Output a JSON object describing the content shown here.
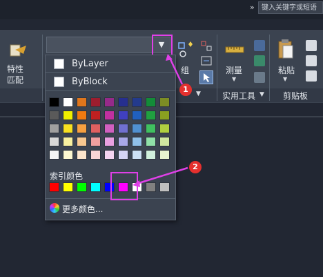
{
  "search": {
    "placeholder": "键入关键字或短语"
  },
  "ribbon": {
    "properties_match": "特性\n匹配",
    "group": "组",
    "measure": "测量",
    "utilities_panel": "实用工具",
    "paste": "粘贴",
    "clipboard_panel": "剪贴板"
  },
  "combo": {
    "value": ""
  },
  "dropdown": {
    "items": [
      {
        "label": "ByLayer"
      },
      {
        "label": "ByBlock"
      }
    ],
    "standard_rows": [
      [
        "#000000",
        "#ffffff",
        "#e0761c",
        "#9c1d2e",
        "#962a8a",
        "#262f8f",
        "#233a8c",
        "#138c38",
        "#7c8d24"
      ],
      [
        "#5a5a5a",
        "#f0f000",
        "#f07a10",
        "#c02020",
        "#c030a0",
        "#4040c0",
        "#2060c0",
        "#20a040",
        "#8aa020"
      ],
      [
        "#a0a0a0",
        "#f8e020",
        "#f8a040",
        "#e06060",
        "#d060c0",
        "#7070d0",
        "#5090d0",
        "#40c060",
        "#b0d040"
      ],
      [
        "#d8d8d8",
        "#f8f0a0",
        "#f8c890",
        "#f0a0a0",
        "#e8a0e0",
        "#a8a8e8",
        "#90c0e8",
        "#90e0a8",
        "#d0e8a0"
      ],
      [
        "#f4f4f4",
        "#fdf8d0",
        "#fde6cc",
        "#f8d4d4",
        "#f4d4f0",
        "#d4d4f4",
        "#cce0f4",
        "#d0f0dc",
        "#e8f4d0"
      ]
    ],
    "index_colors_label": "索引颜色",
    "index_colors": [
      "#ff0000",
      "#ffff00",
      "#00ff00",
      "#00ffff",
      "#0000ff",
      "#ff00ff",
      "#ffffff",
      "#808080",
      "#c0c0c0"
    ],
    "more_colors_label": "更多颜色..."
  },
  "annotations": {
    "badge1": "1",
    "badge2": "2",
    "highlight_color": "#e040e8",
    "badge_color": "#e5302e"
  }
}
